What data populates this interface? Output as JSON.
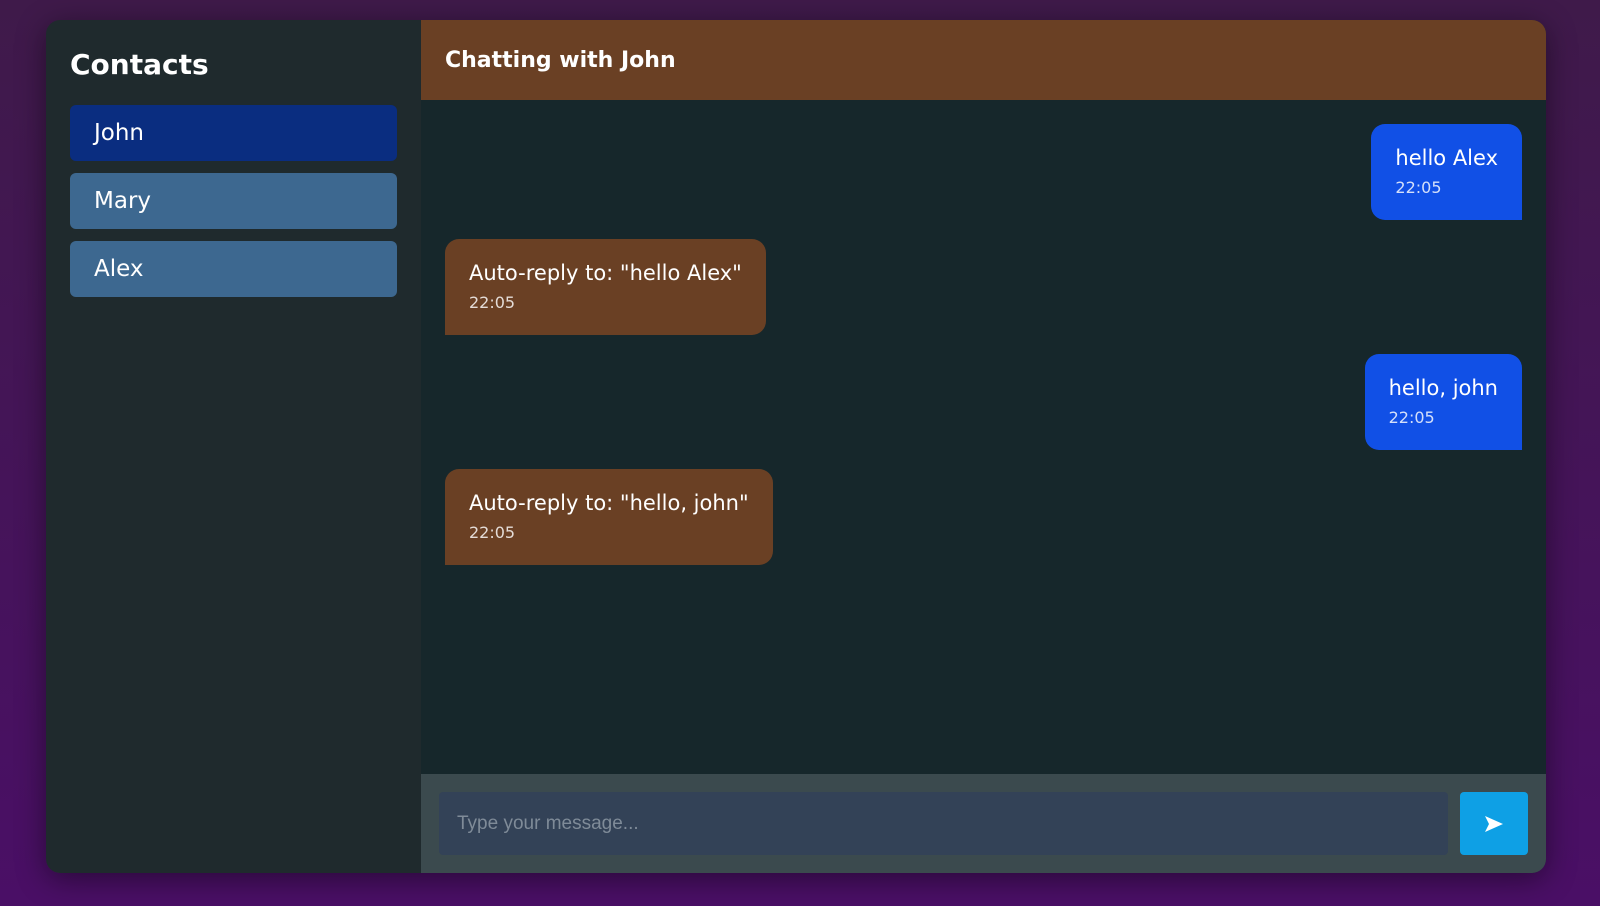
{
  "sidebar": {
    "title": "Contacts",
    "contacts": [
      {
        "name": "John",
        "active": true
      },
      {
        "name": "Mary",
        "active": false
      },
      {
        "name": "Alex",
        "active": false
      }
    ]
  },
  "chat": {
    "header": "Chatting with John",
    "messages": [
      {
        "direction": "sent",
        "text": "hello Alex",
        "time": "22:05"
      },
      {
        "direction": "received",
        "text": "Auto-reply to: \"hello Alex\"",
        "time": "22:05"
      },
      {
        "direction": "sent",
        "text": "hello, john",
        "time": "22:05"
      },
      {
        "direction": "received",
        "text": "Auto-reply to: \"hello, john\"",
        "time": "22:05"
      }
    ]
  },
  "composer": {
    "placeholder": "Type your message...",
    "value": "",
    "send_icon": "send-arrow-icon"
  },
  "colors": {
    "sent_bubble": "#1150e6",
    "received_bubble": "#6a4024",
    "active_contact": "#0a2d80",
    "contact": "#3d6890",
    "send_button": "#0ea0e5"
  }
}
